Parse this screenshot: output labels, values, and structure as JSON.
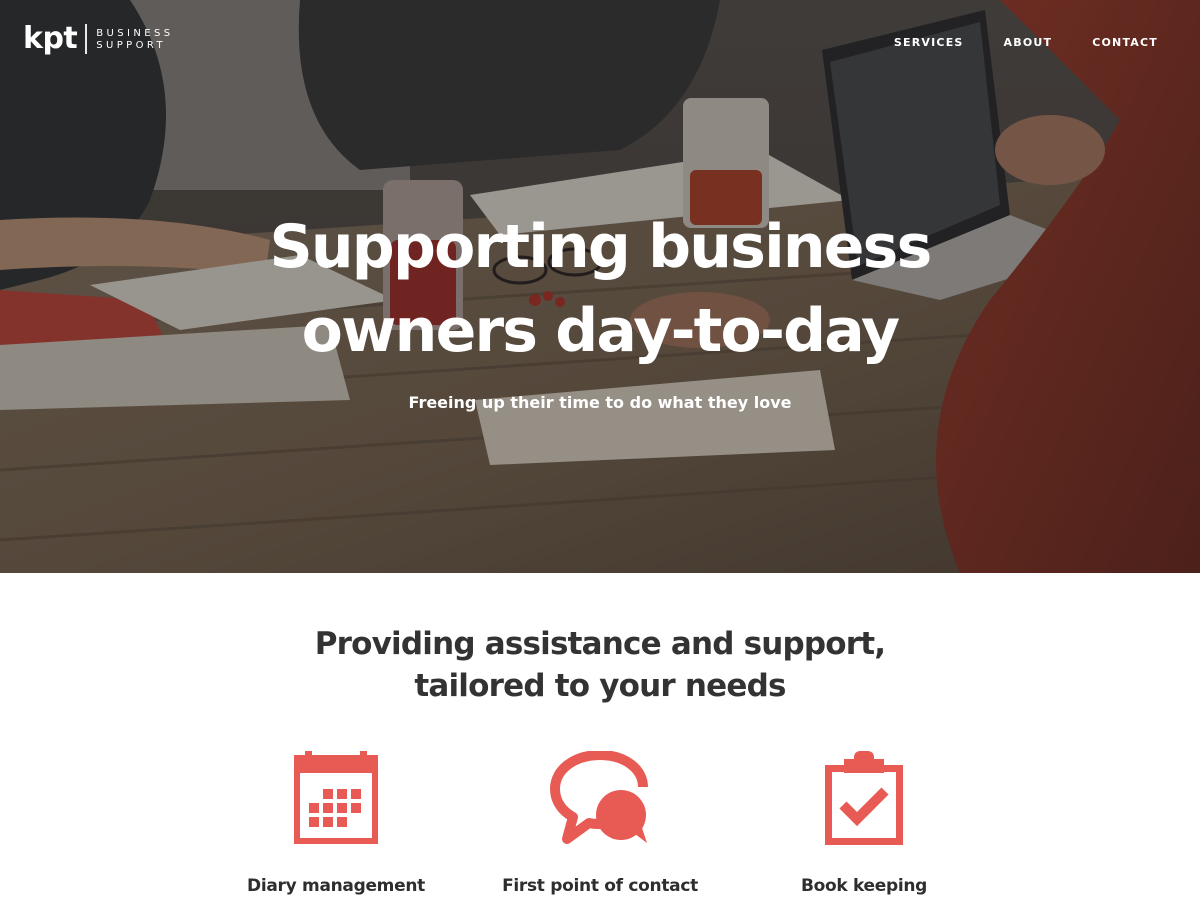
{
  "colors": {
    "accent": "#e85b54",
    "heading_text": "#333333",
    "hero_text": "#ffffff"
  },
  "brand": {
    "logo_text": "kpt",
    "tagline_line1": "BUSINESS",
    "tagline_line2": "SUPPORT"
  },
  "nav": {
    "items": [
      {
        "label": "SERVICES"
      },
      {
        "label": "ABOUT"
      },
      {
        "label": "CONTACT"
      }
    ]
  },
  "hero": {
    "title_line1": "Supporting business",
    "title_line2": "owners day-to-day",
    "subtitle": "Freeing up their time to do what they love",
    "background": "photo of people working around a wooden table with laptop, notebooks and drinks"
  },
  "services": {
    "heading_line1": "Providing assistance and support,",
    "heading_line2": "tailored to your needs",
    "items": [
      {
        "label": "Diary management",
        "icon": "calendar-icon"
      },
      {
        "label": "First point of contact",
        "icon": "chat-bubbles-icon"
      },
      {
        "label": "Book keeping",
        "icon": "clipboard-check-icon"
      }
    ]
  }
}
